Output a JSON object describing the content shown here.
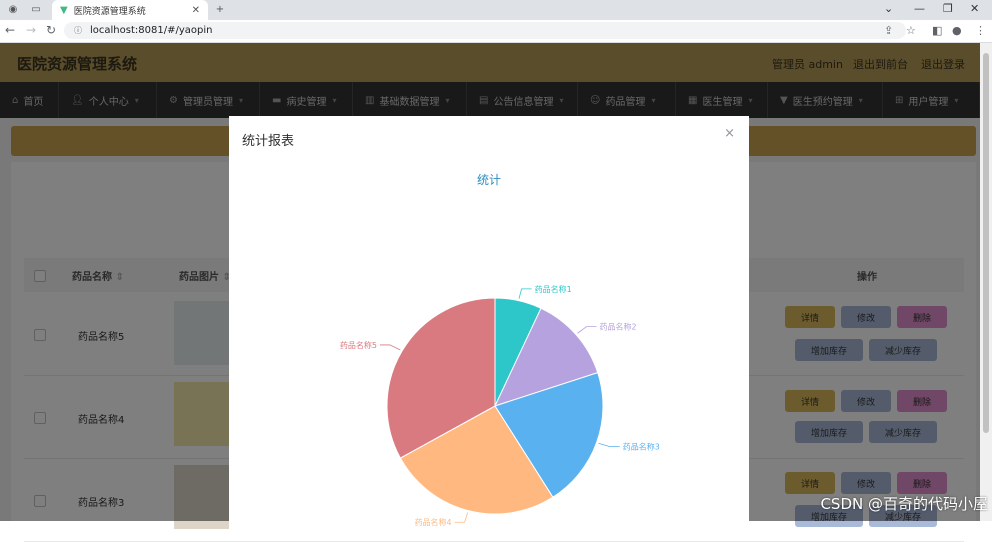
{
  "browser": {
    "tab_title": "医院资源管理系统",
    "url": "localhost:8081/#/yaopin"
  },
  "header": {
    "app_title": "医院资源管理系统",
    "role_user": "管理员 admin",
    "back_to_frontend": "退出到前台",
    "logout": "退出登录"
  },
  "menu": [
    {
      "label": "首页",
      "icon": "home-icon"
    },
    {
      "label": "个人中心",
      "icon": "user-icon"
    },
    {
      "label": "管理员管理",
      "icon": "admin-icon"
    },
    {
      "label": "病史管理",
      "icon": "history-icon"
    },
    {
      "label": "基础数据管理",
      "icon": "data-icon"
    },
    {
      "label": "公告信息管理",
      "icon": "notice-icon"
    },
    {
      "label": "药品管理",
      "icon": "medicine-icon"
    },
    {
      "label": "医生管理",
      "icon": "doctor-icon"
    },
    {
      "label": "医生预约管理",
      "icon": "appointment-icon"
    },
    {
      "label": "用户管理",
      "icon": "users-icon"
    }
  ],
  "table": {
    "headers": [
      "药品名称",
      "药品图片",
      "操作"
    ],
    "rows": [
      {
        "name": "药品名称5"
      },
      {
        "name": "药品名称4"
      },
      {
        "name": "药品名称3"
      }
    ],
    "actions": {
      "detail": "详情",
      "edit": "修改",
      "delete": "删除",
      "add_stock": "增加库存",
      "reduce_stock": "减少库存"
    }
  },
  "modal": {
    "title": "统计报表",
    "close": "×"
  },
  "chart_data": {
    "type": "pie",
    "title": "统计",
    "categories": [
      "药品名称1",
      "药品名称2",
      "药品名称3",
      "药品名称4",
      "药品名称5"
    ],
    "values": [
      7,
      13,
      21,
      26,
      33
    ],
    "colors": [
      "#2ec7c9",
      "#b6a2de",
      "#5ab1ef",
      "#ffb980",
      "#d87a80"
    ]
  },
  "watermark": "CSDN @百奇的代码小屋"
}
